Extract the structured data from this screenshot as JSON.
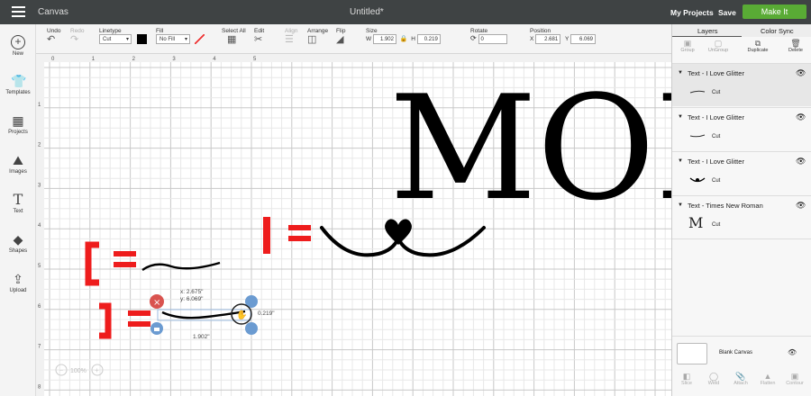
{
  "topbar": {
    "app_title": "Canvas",
    "doc_title": "Untitled*",
    "my_projects": "My Projects",
    "save": "Save",
    "make_it": "Make It"
  },
  "toolbar": {
    "undo": "Undo",
    "redo": "Redo",
    "linetype_label": "Linetype",
    "linetype_value": "Cut",
    "fill_label": "Fill",
    "fill_value": "No Fill",
    "select_all": "Select All",
    "edit": "Edit",
    "align": "Align",
    "arrange": "Arrange",
    "flip": "Flip",
    "size_label": "Size",
    "size_w_label": "W",
    "size_w": "1.902",
    "size_h_label": "H",
    "size_h": "0.219",
    "rotate_label": "Rotate",
    "rotate_value": "0",
    "position_label": "Position",
    "pos_x_label": "X",
    "pos_x": "2.681",
    "pos_y_label": "Y",
    "pos_y": "6.069"
  },
  "leftbar": {
    "items": [
      {
        "label": "New",
        "icon": "plus-circle-icon"
      },
      {
        "label": "Templates",
        "icon": "shirt-icon"
      },
      {
        "label": "Projects",
        "icon": "grid-icon"
      },
      {
        "label": "Images",
        "icon": "image-icon"
      },
      {
        "label": "Text",
        "icon": "text-icon"
      },
      {
        "label": "Shapes",
        "icon": "shapes-icon"
      },
      {
        "label": "Upload",
        "icon": "upload-icon"
      }
    ]
  },
  "ruler": {
    "h": [
      "0",
      "1",
      "2",
      "3",
      "4",
      "5"
    ],
    "v": [
      "1",
      "2",
      "3",
      "4",
      "5",
      "6",
      "7",
      "8"
    ]
  },
  "canvas": {
    "big_text": "MOI",
    "sel_x": "x: 2.675\"",
    "sel_y": "y: 6.069\"",
    "dim_h": "0.219\"",
    "dim_w": "1.902\"",
    "zoom": "100%",
    "colors": {
      "accent": "#ee1c1c",
      "handle_blue": "#6b9bd1",
      "handle_red": "#d9534f"
    }
  },
  "panel": {
    "tab_layers": "Layers",
    "tab_color_sync": "Color Sync",
    "actions": [
      "Group",
      "UnGroup",
      "Duplicate",
      "Delete"
    ],
    "layers": [
      {
        "title": "Text - I Love Glitter",
        "cut": "Cut"
      },
      {
        "title": "Text - I Love Glitter",
        "cut": "Cut"
      },
      {
        "title": "Text - I Love Glitter",
        "cut": "Cut"
      },
      {
        "title": "Text - Times New Roman",
        "cut": "Cut",
        "thumb": "M"
      }
    ],
    "blank_canvas": "Blank Canvas",
    "bottom_actions": [
      "Slice",
      "Weld",
      "Attach",
      "Flatten",
      "Contour"
    ]
  }
}
